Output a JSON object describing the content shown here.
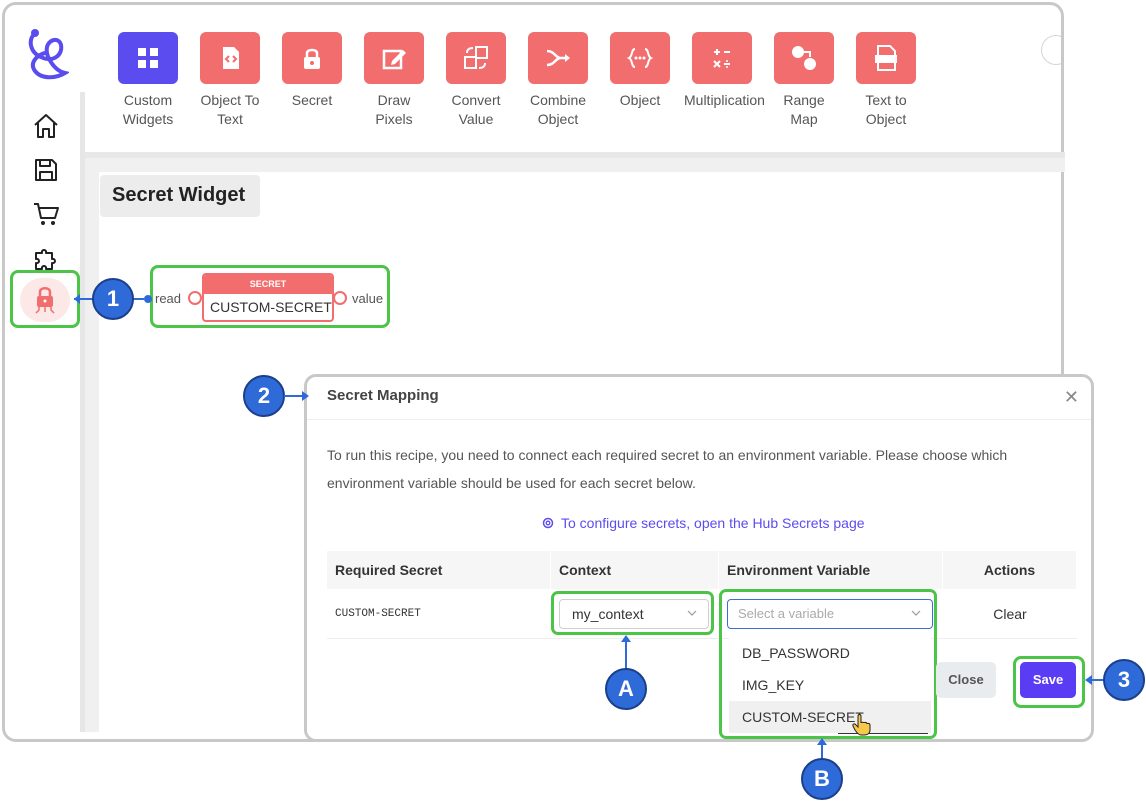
{
  "toolbar": {
    "items": [
      {
        "label": "Custom\nWidgets",
        "icon": "grid-icon",
        "color": "#5b4cf0"
      },
      {
        "label": "Object To\nText",
        "icon": "code-file-icon",
        "color": "#f26d6d"
      },
      {
        "label": "Secret",
        "icon": "lock-icon",
        "color": "#f26d6d"
      },
      {
        "label": "Draw\nPixels",
        "icon": "pencil-square-icon",
        "color": "#f26d6d"
      },
      {
        "label": "Convert\nValue",
        "icon": "convert-icon",
        "color": "#f26d6d"
      },
      {
        "label": "Combine\nObject",
        "icon": "merge-arrow-icon",
        "color": "#f26d6d"
      },
      {
        "label": "Object",
        "icon": "braces-icon",
        "color": "#f26d6d"
      },
      {
        "label": "Multiplication",
        "icon": "math-operators-icon",
        "color": "#f26d6d"
      },
      {
        "label": "Range\nMap",
        "icon": "range-map-icon",
        "color": "#f26d6d"
      },
      {
        "label": "Text to\nObject",
        "icon": "json-file-icon",
        "color": "#f26d6d"
      }
    ]
  },
  "canvas": {
    "tab_title": "Secret Widget",
    "node": {
      "header": "SECRET",
      "value": "CUSTOM-SECRET",
      "input_label": "read",
      "output_label": "value"
    }
  },
  "callouts": {
    "one": "1",
    "two": "2",
    "three": "3",
    "a": "A",
    "b": "B"
  },
  "modal": {
    "title": "Secret Mapping",
    "description": "To run this recipe, you need to connect each required secret to an environment variable. Please choose which environment variable should be used for each secret below.",
    "hub_link": "To configure secrets, open the Hub Secrets page",
    "table": {
      "headers": [
        "Required Secret",
        "Context",
        "Environment Variable",
        "Actions"
      ],
      "row": {
        "secret": "CUSTOM-SECRET",
        "context": "my_context",
        "env_placeholder": "Select a variable",
        "action": "Clear"
      }
    },
    "dropdown_options": [
      "DB_PASSWORD",
      "IMG_KEY",
      "CUSTOM-SECRET"
    ],
    "close_label": "Close",
    "save_label": "Save"
  },
  "colors": {
    "accent": "#5b4cf0",
    "tile": "#f26d6d",
    "highlight": "#4cc448",
    "callout": "#2f6ad9"
  }
}
